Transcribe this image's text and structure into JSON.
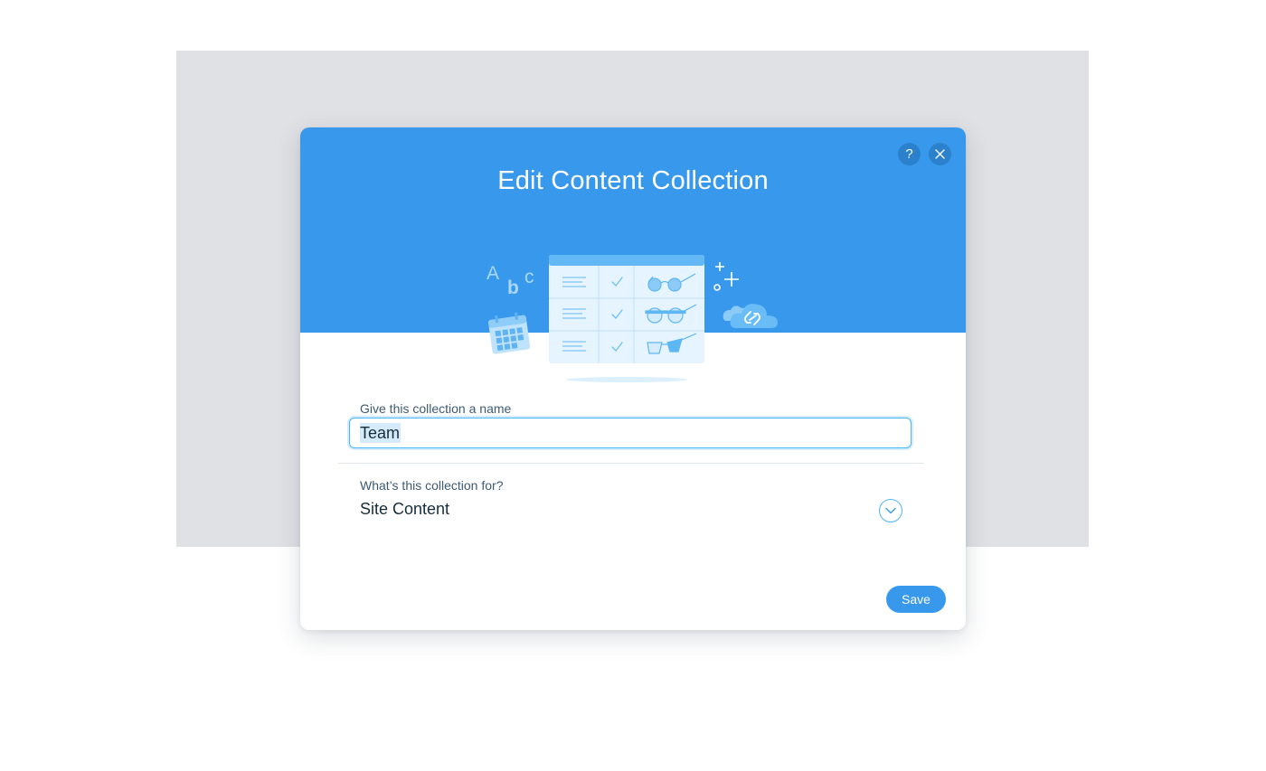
{
  "dialog": {
    "title": "Edit Content Collection",
    "help_symbol": "?",
    "close_symbol": "✕"
  },
  "illustration": {
    "letters": [
      "A",
      "b",
      "c"
    ]
  },
  "form": {
    "name_label": "Give this collection a name",
    "name_value": "Team",
    "purpose_label": "What’s this collection for?",
    "purpose_value": "Site Content"
  },
  "footer": {
    "save_label": "Save"
  },
  "colors": {
    "header": "#3899ec",
    "backdrop": "#e0e1e5",
    "input_border": "#4eb7f5",
    "text_dark": "#162d3d",
    "text_label": "#3d5a73"
  },
  "icons": [
    "help-icon",
    "close-icon",
    "chevron-down-icon",
    "calendar-icon",
    "table-icon",
    "glasses-icon",
    "cloud-link-icon",
    "sparkle-icon"
  ]
}
